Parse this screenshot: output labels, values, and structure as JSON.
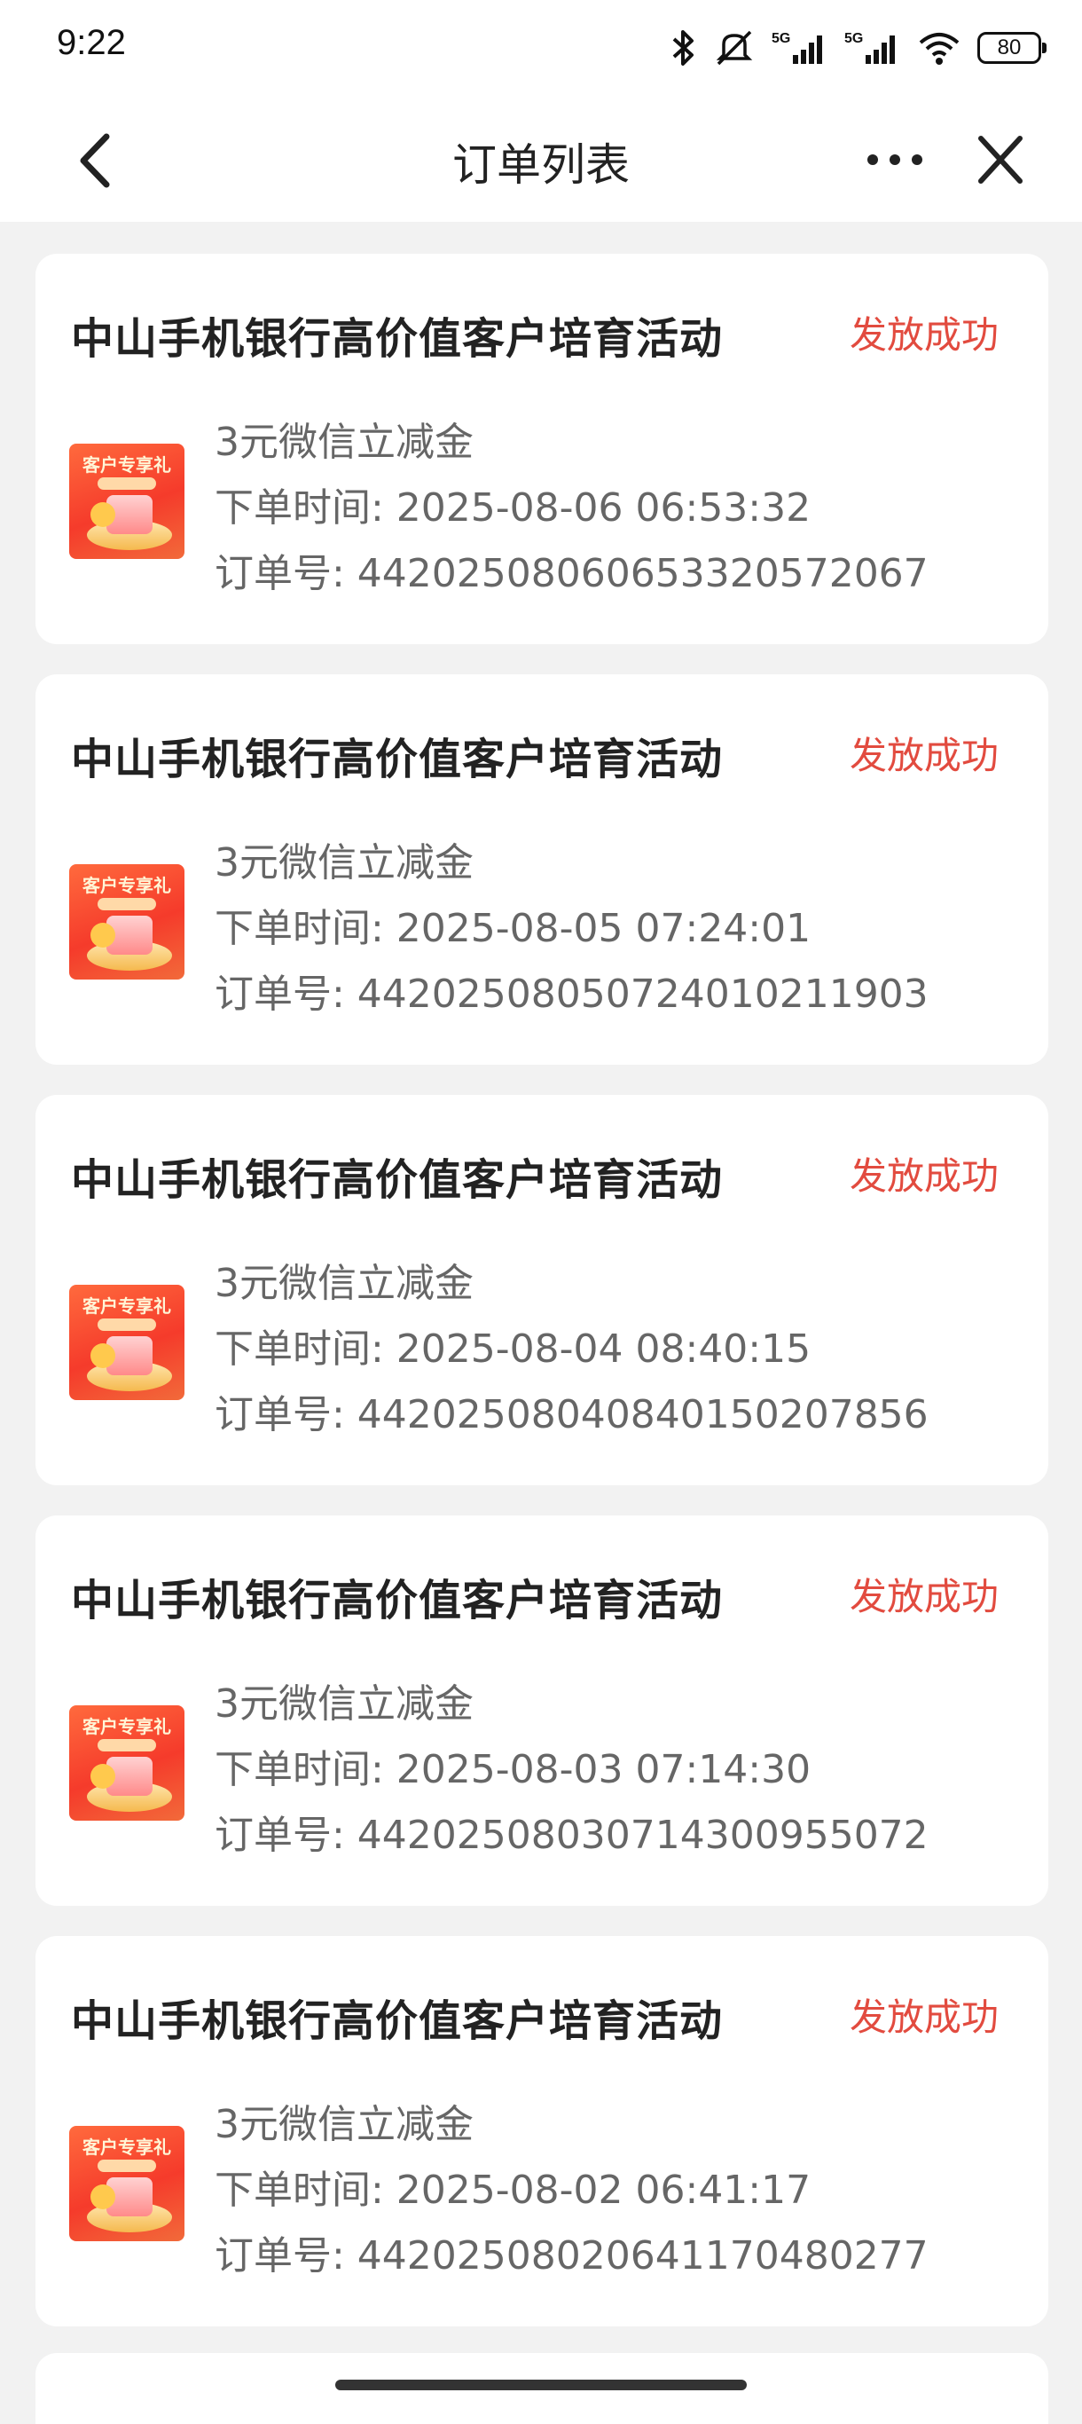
{
  "status_bar": {
    "time": "9:22",
    "battery": "80",
    "network_labels": [
      "5G",
      "5G"
    ]
  },
  "header": {
    "title": "订单列表"
  },
  "orders": [
    {
      "activity": "中山手机银行高价值客户培育活动",
      "status": "发放成功",
      "thumb_label": "客户专享礼",
      "item": "3元微信立减金",
      "time": "下单时间: 2025-08-06 06:53:32",
      "order_no": "订单号: 4420250806065332057206​7"
    },
    {
      "activity": "中山手机银行高价值客户培育活动",
      "status": "发放成功",
      "thumb_label": "客户专享礼",
      "item": "3元微信立减金",
      "time": "下单时间: 2025-08-05 07:24:01",
      "order_no": "订单号: 44202508050724010211903"
    },
    {
      "activity": "中山手机银行高价值客户培育活动",
      "status": "发放成功",
      "thumb_label": "客户专享礼",
      "item": "3元微信立减金",
      "time": "下单时间: 2025-08-04 08:40:15",
      "order_no": "订单号: 44202508040840150207856"
    },
    {
      "activity": "中山手机银行高价值客户培育活动",
      "status": "发放成功",
      "thumb_label": "客户专享礼",
      "item": "3元微信立减金",
      "time": "下单时间: 2025-08-03 07:14:30",
      "order_no": "订单号: 44202508030714300955072"
    },
    {
      "activity": "中山手机银行高价值客户培育活动",
      "status": "发放成功",
      "thumb_label": "客户专享礼",
      "item": "3元微信立减金",
      "time": "下单时间: 2025-08-02 06:41:17",
      "order_no": "订单号: 44202508020641170480277"
    }
  ],
  "colors": {
    "status_success": "#e24b3f",
    "background": "#f2f2f2",
    "card": "#ffffff"
  },
  "icons": [
    "bluetooth-icon",
    "mute-icon",
    "signal-icon",
    "wifi-icon",
    "back-icon",
    "more-icon",
    "close-icon"
  ]
}
